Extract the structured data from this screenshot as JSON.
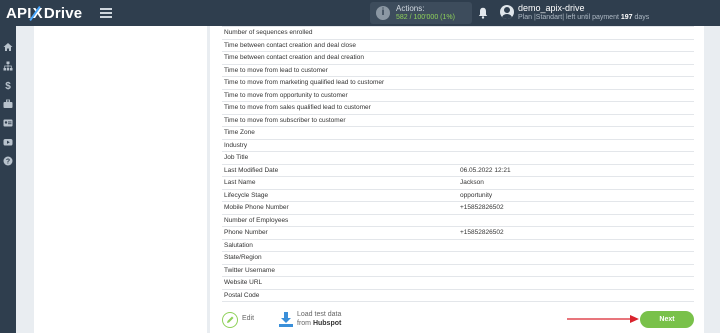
{
  "header": {
    "logo": {
      "part1": "API",
      "x": "X",
      "part2": "Drive"
    },
    "actions": {
      "label": "Actions:",
      "value": "582 / 100'000  (1%)"
    },
    "user": {
      "name": "demo_apix-drive",
      "plan_prefix": "Plan |Standart| left until payment ",
      "days": "197",
      "days_suffix": " days"
    }
  },
  "sidebar": {
    "icons": [
      "home-icon",
      "sitemap-icon",
      "dollar-icon",
      "briefcase-icon",
      "id-card-icon",
      "youtube-icon",
      "help-icon"
    ]
  },
  "fields": [
    {
      "name": "Number of sequences enrolled",
      "value": ""
    },
    {
      "name": "Time between contact creation and deal close",
      "value": ""
    },
    {
      "name": "Time between contact creation and deal creation",
      "value": ""
    },
    {
      "name": "Time to move from lead to customer",
      "value": ""
    },
    {
      "name": "Time to move from marketing qualified lead to customer",
      "value": ""
    },
    {
      "name": "Time to move from opportunity to customer",
      "value": ""
    },
    {
      "name": "Time to move from sales qualified lead to customer",
      "value": ""
    },
    {
      "name": "Time to move from subscriber to customer",
      "value": ""
    },
    {
      "name": "Time Zone",
      "value": ""
    },
    {
      "name": "Industry",
      "value": ""
    },
    {
      "name": "Job Title",
      "value": ""
    },
    {
      "name": "Last Modified Date",
      "value": "06.05.2022 12:21"
    },
    {
      "name": "Last Name",
      "value": "Jackson"
    },
    {
      "name": "Lifecycle Stage",
      "value": "opportunity"
    },
    {
      "name": "Mobile Phone Number",
      "value": "+15852826502"
    },
    {
      "name": "Number of Employees",
      "value": ""
    },
    {
      "name": "Phone Number",
      "value": "+15852826502"
    },
    {
      "name": "Salutation",
      "value": ""
    },
    {
      "name": "State/Region",
      "value": ""
    },
    {
      "name": "Twitter Username",
      "value": ""
    },
    {
      "name": "Website URL",
      "value": ""
    },
    {
      "name": "Postal Code",
      "value": ""
    }
  ],
  "controls": {
    "edit_label": "Edit",
    "load_line1": "Load test data",
    "load_prefix": "from ",
    "load_source": "Hubspot",
    "next_label": "Next"
  },
  "colors": {
    "topbar": "#2f3e4e",
    "accent_green": "#79c14a",
    "arrow_red": "#d9232d",
    "actions_green": "#8fd15a"
  }
}
